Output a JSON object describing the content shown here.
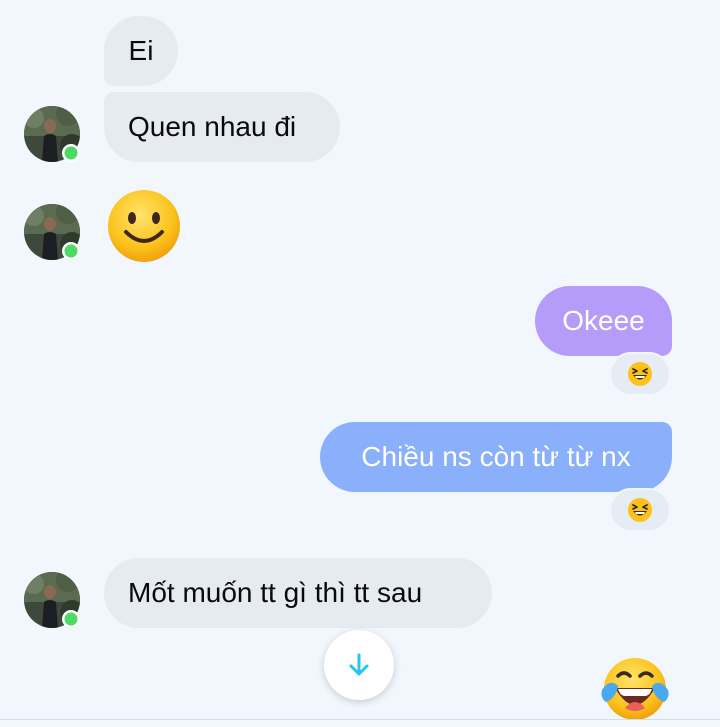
{
  "conversation": {
    "messages": [
      {
        "sender": "other",
        "text": "Ei"
      },
      {
        "sender": "other",
        "text": "Quen nhau đi"
      },
      {
        "sender": "other",
        "emoji": "slightly-smiling-face"
      },
      {
        "sender": "me",
        "text": "Okeee",
        "reaction": "grinning-squinting-face"
      },
      {
        "sender": "me",
        "text": "Chiều ns còn từ từ nx",
        "reaction": "grinning-squinting-face"
      },
      {
        "sender": "other",
        "text": "Mốt muốn tt gì thì tt sau"
      }
    ]
  },
  "contact": {
    "status": "online",
    "status_color": "#4cd964"
  },
  "colors": {
    "background": "#f1f7fd",
    "incoming_bubble": "#e6ebf2",
    "outgoing_bubble_1": "#b59cfa",
    "outgoing_bubble_2": "#8aaffb",
    "scroll_arrow": "#22c6ee"
  },
  "composer": {
    "quick_reaction_icon": "face-with-tears-of-joy-icon"
  }
}
